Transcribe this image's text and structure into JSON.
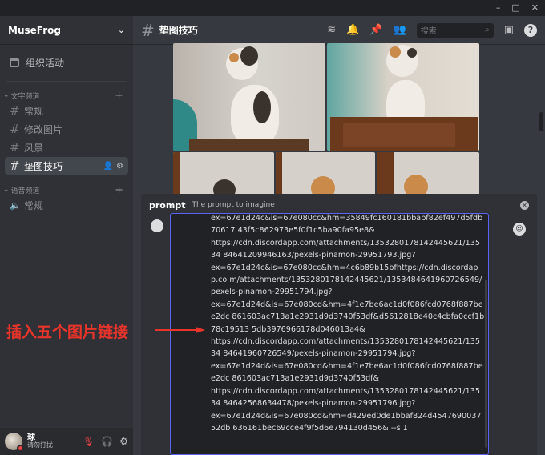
{
  "window": {
    "controls": [
      "–",
      "□",
      "✕"
    ]
  },
  "server": {
    "name": "MuseFrog",
    "events_label": "组织活动"
  },
  "categories": {
    "text": "文字频道",
    "voice": "语音频道"
  },
  "text_channels": [
    "常规",
    "修改图片",
    "风景",
    "垫图技巧"
  ],
  "voice_channels": [
    "常规"
  ],
  "user": {
    "name": "球",
    "status": "请勿打扰"
  },
  "channel": {
    "name": "垫图技巧"
  },
  "search": {
    "placeholder": "搜索"
  },
  "prompt": {
    "label": "prompt",
    "description": "The prompt to imagine",
    "text": "ex=67e1d24c&is=67e080cc&hm=35849fc160181bbabf82ef497d5fdb70617 43f5c862973e5f0f1c5ba90fa95e8&\nhttps://cdn.discordapp.com/attachments/1353280178142445621/13534 84641209946163/pexels-pinamon-29951793.jpg?\nex=67e1d24c&is=67e080cc&hm=4c6b89b15bfhttps://cdn.discordapp.co m/attachments/1353280178142445621/1353484641960726549/pexels-pinamon-29951794.jpg?\nex=67e1d24d&is=67e080cd&hm=4f1e7be6ac1d0f086fcd0768f887bee2dc 861603ac713a1e2931d9d3740f53df&d5612818e40c4cbfa0ccf1b78c19513 5db3976966178d046013a4&\nhttps://cdn.discordapp.com/attachments/1353280178142445621/13534 84641960726549/pexels-pinamon-29951794.jpg?\nex=67e1d24d&is=67e080cd&hm=4f1e7be6ac1d0f086fcd0768f887bee2dc 861603ac713a1e2931d9d3740f53df&\nhttps://cdn.discordapp.com/attachments/1353280178142445621/13534 84642568634478/pexels-pinamon-29951796.jpg?\nex=67e1d24d&is=67e080cd&hm=d429ed0de1bbaf824d454769003752db 636161bec69cce4f9f5d6e794130d456& --s 1"
  },
  "annotation": {
    "text": "插入五个图片链接"
  },
  "colors": {
    "accent": "#5865f2",
    "annotation": "#e8342a",
    "dnd": "#ed4245"
  }
}
